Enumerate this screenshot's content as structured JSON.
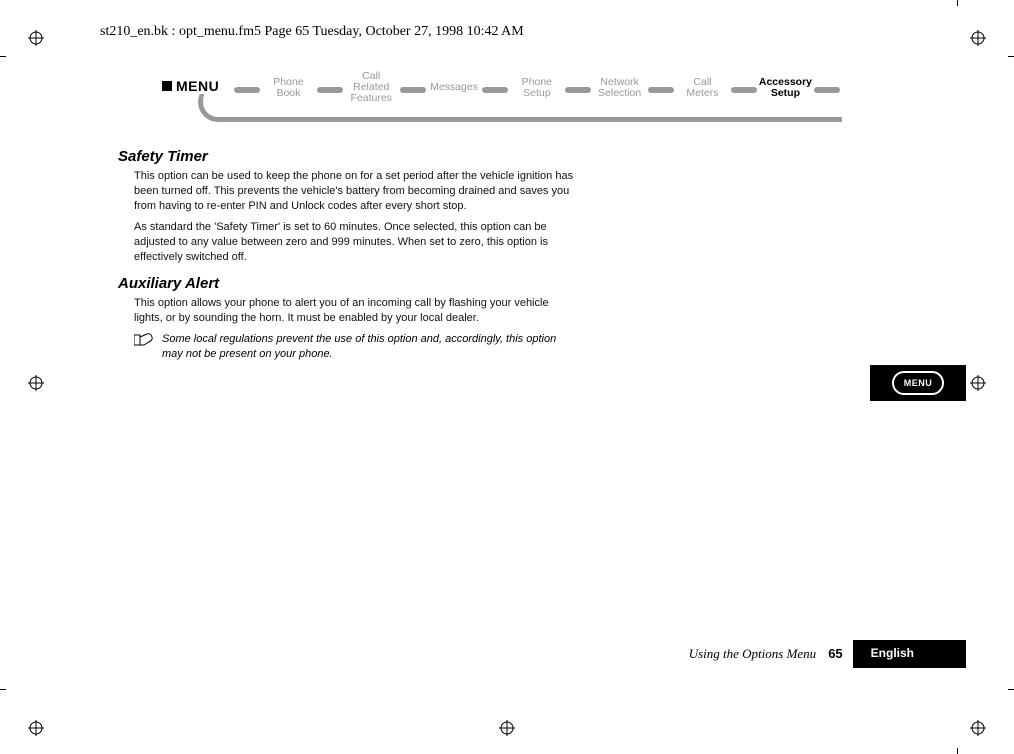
{
  "header": {
    "filepath": "st210_en.bk : opt_menu.fm5  Page 65  Tuesday, October 27, 1998  10:42 AM"
  },
  "menubar": {
    "menu_label": "MENU",
    "items": [
      {
        "line1": "Phone",
        "line2": "Book",
        "bold": false
      },
      {
        "line1": "Call Related",
        "line2": "Features",
        "bold": false
      },
      {
        "line1": "Messages",
        "line2": "",
        "bold": false
      },
      {
        "line1": "Phone",
        "line2": "Setup",
        "bold": false
      },
      {
        "line1": "Network",
        "line2": "Selection",
        "bold": false
      },
      {
        "line1": "Call",
        "line2": "Meters",
        "bold": false
      },
      {
        "line1": "Accessory",
        "line2": "Setup",
        "bold": true
      }
    ]
  },
  "sections": [
    {
      "heading": "Safety Timer",
      "paragraphs": [
        "This option can be used to keep the phone on for a set period after the vehicle ignition has been turned off. This prevents the vehicle's battery from becoming drained and saves you from having to re-enter PIN and Unlock codes after every short stop.",
        "As standard the 'Safety Timer' is set to 60 minutes. Once selected, this option can be adjusted to any value between zero and 999 minutes. When set to zero, this option is effectively switched off."
      ]
    },
    {
      "heading": "Auxiliary Alert",
      "paragraphs": [
        "This option allows your phone to alert you of an incoming call by flashing your vehicle lights, or by sounding the horn. It must be enabled by your local dealer."
      ],
      "note": "Some local regulations prevent the use of this option and, accordingly, this option may not be present on your phone."
    }
  ],
  "sidetab": {
    "label": "MENU"
  },
  "footer": {
    "chapter": "Using the Options Menu",
    "page": "65",
    "language": "English"
  }
}
